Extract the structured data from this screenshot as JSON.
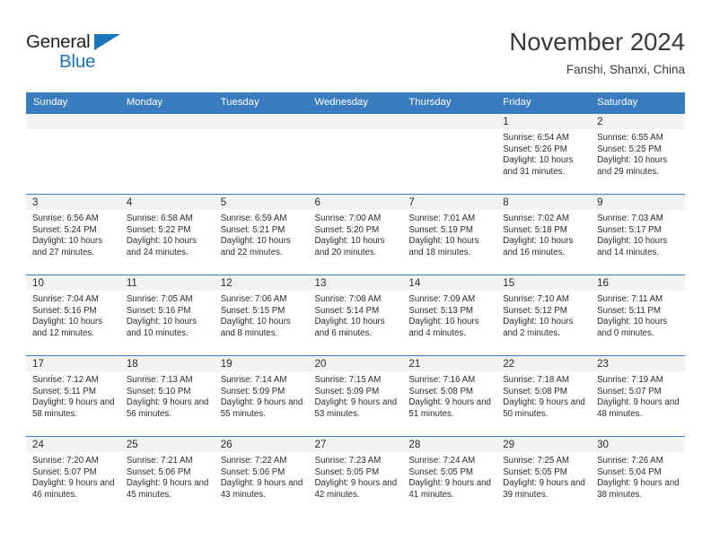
{
  "brand": {
    "name_top": "General",
    "name_bottom": "Blue",
    "triangle_icon": "blue-triangle-icon",
    "color_dark": "#231f20",
    "color_blue": "#1b75bb"
  },
  "header": {
    "title": "November 2024",
    "subtitle": "Fanshi, Shanxi, China"
  },
  "theme": {
    "header_blue": "#3a7dbf",
    "daynum_band": "#f2f2f2",
    "text": "#2b2b2b"
  },
  "weekdays": [
    "Sunday",
    "Monday",
    "Tuesday",
    "Wednesday",
    "Thursday",
    "Friday",
    "Saturday"
  ],
  "weeks": [
    [
      {
        "day": "",
        "empty": true
      },
      {
        "day": "",
        "empty": true
      },
      {
        "day": "",
        "empty": true
      },
      {
        "day": "",
        "empty": true
      },
      {
        "day": "",
        "empty": true
      },
      {
        "day": "1",
        "sunrise": "Sunrise: 6:54 AM",
        "sunset": "Sunset: 5:26 PM",
        "daylight": "Daylight: 10 hours and 31 minutes."
      },
      {
        "day": "2",
        "sunrise": "Sunrise: 6:55 AM",
        "sunset": "Sunset: 5:25 PM",
        "daylight": "Daylight: 10 hours and 29 minutes."
      }
    ],
    [
      {
        "day": "3",
        "sunrise": "Sunrise: 6:56 AM",
        "sunset": "Sunset: 5:24 PM",
        "daylight": "Daylight: 10 hours and 27 minutes."
      },
      {
        "day": "4",
        "sunrise": "Sunrise: 6:58 AM",
        "sunset": "Sunset: 5:22 PM",
        "daylight": "Daylight: 10 hours and 24 minutes."
      },
      {
        "day": "5",
        "sunrise": "Sunrise: 6:59 AM",
        "sunset": "Sunset: 5:21 PM",
        "daylight": "Daylight: 10 hours and 22 minutes."
      },
      {
        "day": "6",
        "sunrise": "Sunrise: 7:00 AM",
        "sunset": "Sunset: 5:20 PM",
        "daylight": "Daylight: 10 hours and 20 minutes."
      },
      {
        "day": "7",
        "sunrise": "Sunrise: 7:01 AM",
        "sunset": "Sunset: 5:19 PM",
        "daylight": "Daylight: 10 hours and 18 minutes."
      },
      {
        "day": "8",
        "sunrise": "Sunrise: 7:02 AM",
        "sunset": "Sunset: 5:18 PM",
        "daylight": "Daylight: 10 hours and 16 minutes."
      },
      {
        "day": "9",
        "sunrise": "Sunrise: 7:03 AM",
        "sunset": "Sunset: 5:17 PM",
        "daylight": "Daylight: 10 hours and 14 minutes."
      }
    ],
    [
      {
        "day": "10",
        "sunrise": "Sunrise: 7:04 AM",
        "sunset": "Sunset: 5:16 PM",
        "daylight": "Daylight: 10 hours and 12 minutes."
      },
      {
        "day": "11",
        "sunrise": "Sunrise: 7:05 AM",
        "sunset": "Sunset: 5:16 PM",
        "daylight": "Daylight: 10 hours and 10 minutes."
      },
      {
        "day": "12",
        "sunrise": "Sunrise: 7:06 AM",
        "sunset": "Sunset: 5:15 PM",
        "daylight": "Daylight: 10 hours and 8 minutes."
      },
      {
        "day": "13",
        "sunrise": "Sunrise: 7:08 AM",
        "sunset": "Sunset: 5:14 PM",
        "daylight": "Daylight: 10 hours and 6 minutes."
      },
      {
        "day": "14",
        "sunrise": "Sunrise: 7:09 AM",
        "sunset": "Sunset: 5:13 PM",
        "daylight": "Daylight: 10 hours and 4 minutes."
      },
      {
        "day": "15",
        "sunrise": "Sunrise: 7:10 AM",
        "sunset": "Sunset: 5:12 PM",
        "daylight": "Daylight: 10 hours and 2 minutes."
      },
      {
        "day": "16",
        "sunrise": "Sunrise: 7:11 AM",
        "sunset": "Sunset: 5:11 PM",
        "daylight": "Daylight: 10 hours and 0 minutes."
      }
    ],
    [
      {
        "day": "17",
        "sunrise": "Sunrise: 7:12 AM",
        "sunset": "Sunset: 5:11 PM",
        "daylight": "Daylight: 9 hours and 58 minutes."
      },
      {
        "day": "18",
        "sunrise": "Sunrise: 7:13 AM",
        "sunset": "Sunset: 5:10 PM",
        "daylight": "Daylight: 9 hours and 56 minutes."
      },
      {
        "day": "19",
        "sunrise": "Sunrise: 7:14 AM",
        "sunset": "Sunset: 5:09 PM",
        "daylight": "Daylight: 9 hours and 55 minutes."
      },
      {
        "day": "20",
        "sunrise": "Sunrise: 7:15 AM",
        "sunset": "Sunset: 5:09 PM",
        "daylight": "Daylight: 9 hours and 53 minutes."
      },
      {
        "day": "21",
        "sunrise": "Sunrise: 7:16 AM",
        "sunset": "Sunset: 5:08 PM",
        "daylight": "Daylight: 9 hours and 51 minutes."
      },
      {
        "day": "22",
        "sunrise": "Sunrise: 7:18 AM",
        "sunset": "Sunset: 5:08 PM",
        "daylight": "Daylight: 9 hours and 50 minutes."
      },
      {
        "day": "23",
        "sunrise": "Sunrise: 7:19 AM",
        "sunset": "Sunset: 5:07 PM",
        "daylight": "Daylight: 9 hours and 48 minutes."
      }
    ],
    [
      {
        "day": "24",
        "sunrise": "Sunrise: 7:20 AM",
        "sunset": "Sunset: 5:07 PM",
        "daylight": "Daylight: 9 hours and 46 minutes."
      },
      {
        "day": "25",
        "sunrise": "Sunrise: 7:21 AM",
        "sunset": "Sunset: 5:06 PM",
        "daylight": "Daylight: 9 hours and 45 minutes."
      },
      {
        "day": "26",
        "sunrise": "Sunrise: 7:22 AM",
        "sunset": "Sunset: 5:06 PM",
        "daylight": "Daylight: 9 hours and 43 minutes."
      },
      {
        "day": "27",
        "sunrise": "Sunrise: 7:23 AM",
        "sunset": "Sunset: 5:05 PM",
        "daylight": "Daylight: 9 hours and 42 minutes."
      },
      {
        "day": "28",
        "sunrise": "Sunrise: 7:24 AM",
        "sunset": "Sunset: 5:05 PM",
        "daylight": "Daylight: 9 hours and 41 minutes."
      },
      {
        "day": "29",
        "sunrise": "Sunrise: 7:25 AM",
        "sunset": "Sunset: 5:05 PM",
        "daylight": "Daylight: 9 hours and 39 minutes."
      },
      {
        "day": "30",
        "sunrise": "Sunrise: 7:26 AM",
        "sunset": "Sunset: 5:04 PM",
        "daylight": "Daylight: 9 hours and 38 minutes."
      }
    ]
  ]
}
